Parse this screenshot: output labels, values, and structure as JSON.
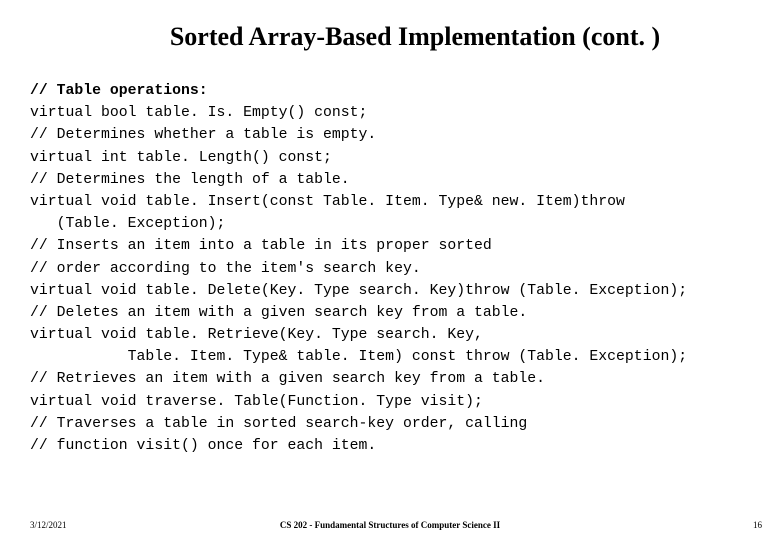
{
  "title": "Sorted Array-Based Implementation (cont. )",
  "code": {
    "l0": "// Table operations:",
    "l1": "virtual bool table. Is. Empty() const;",
    "l2": "// Determines whether a table is empty.",
    "l3": "virtual int table. Length() const;",
    "l4": "// Determines the length of a table.",
    "l5": "virtual void table. Insert(const Table. Item. Type& new. Item)throw",
    "l6": "   (Table. Exception);",
    "l7": "// Inserts an item into a table in its proper sorted",
    "l8": "// order according to the item's search key.",
    "l9": "virtual void table. Delete(Key. Type search. Key)throw (Table. Exception);",
    "l10": "// Deletes an item with a given search key from a table.",
    "l11": "virtual void table. Retrieve(Key. Type search. Key,",
    "l12": "           Table. Item. Type& table. Item) const throw (Table. Exception);",
    "l13": "// Retrieves an item with a given search key from a table.",
    "l14": "virtual void traverse. Table(Function. Type visit);",
    "l15": "// Traverses a table in sorted search-key order, calling",
    "l16": "// function visit() once for each item."
  },
  "footer": {
    "date": "3/12/2021",
    "course": "CS 202 - Fundamental Structures of Computer Science II",
    "page": "16"
  }
}
